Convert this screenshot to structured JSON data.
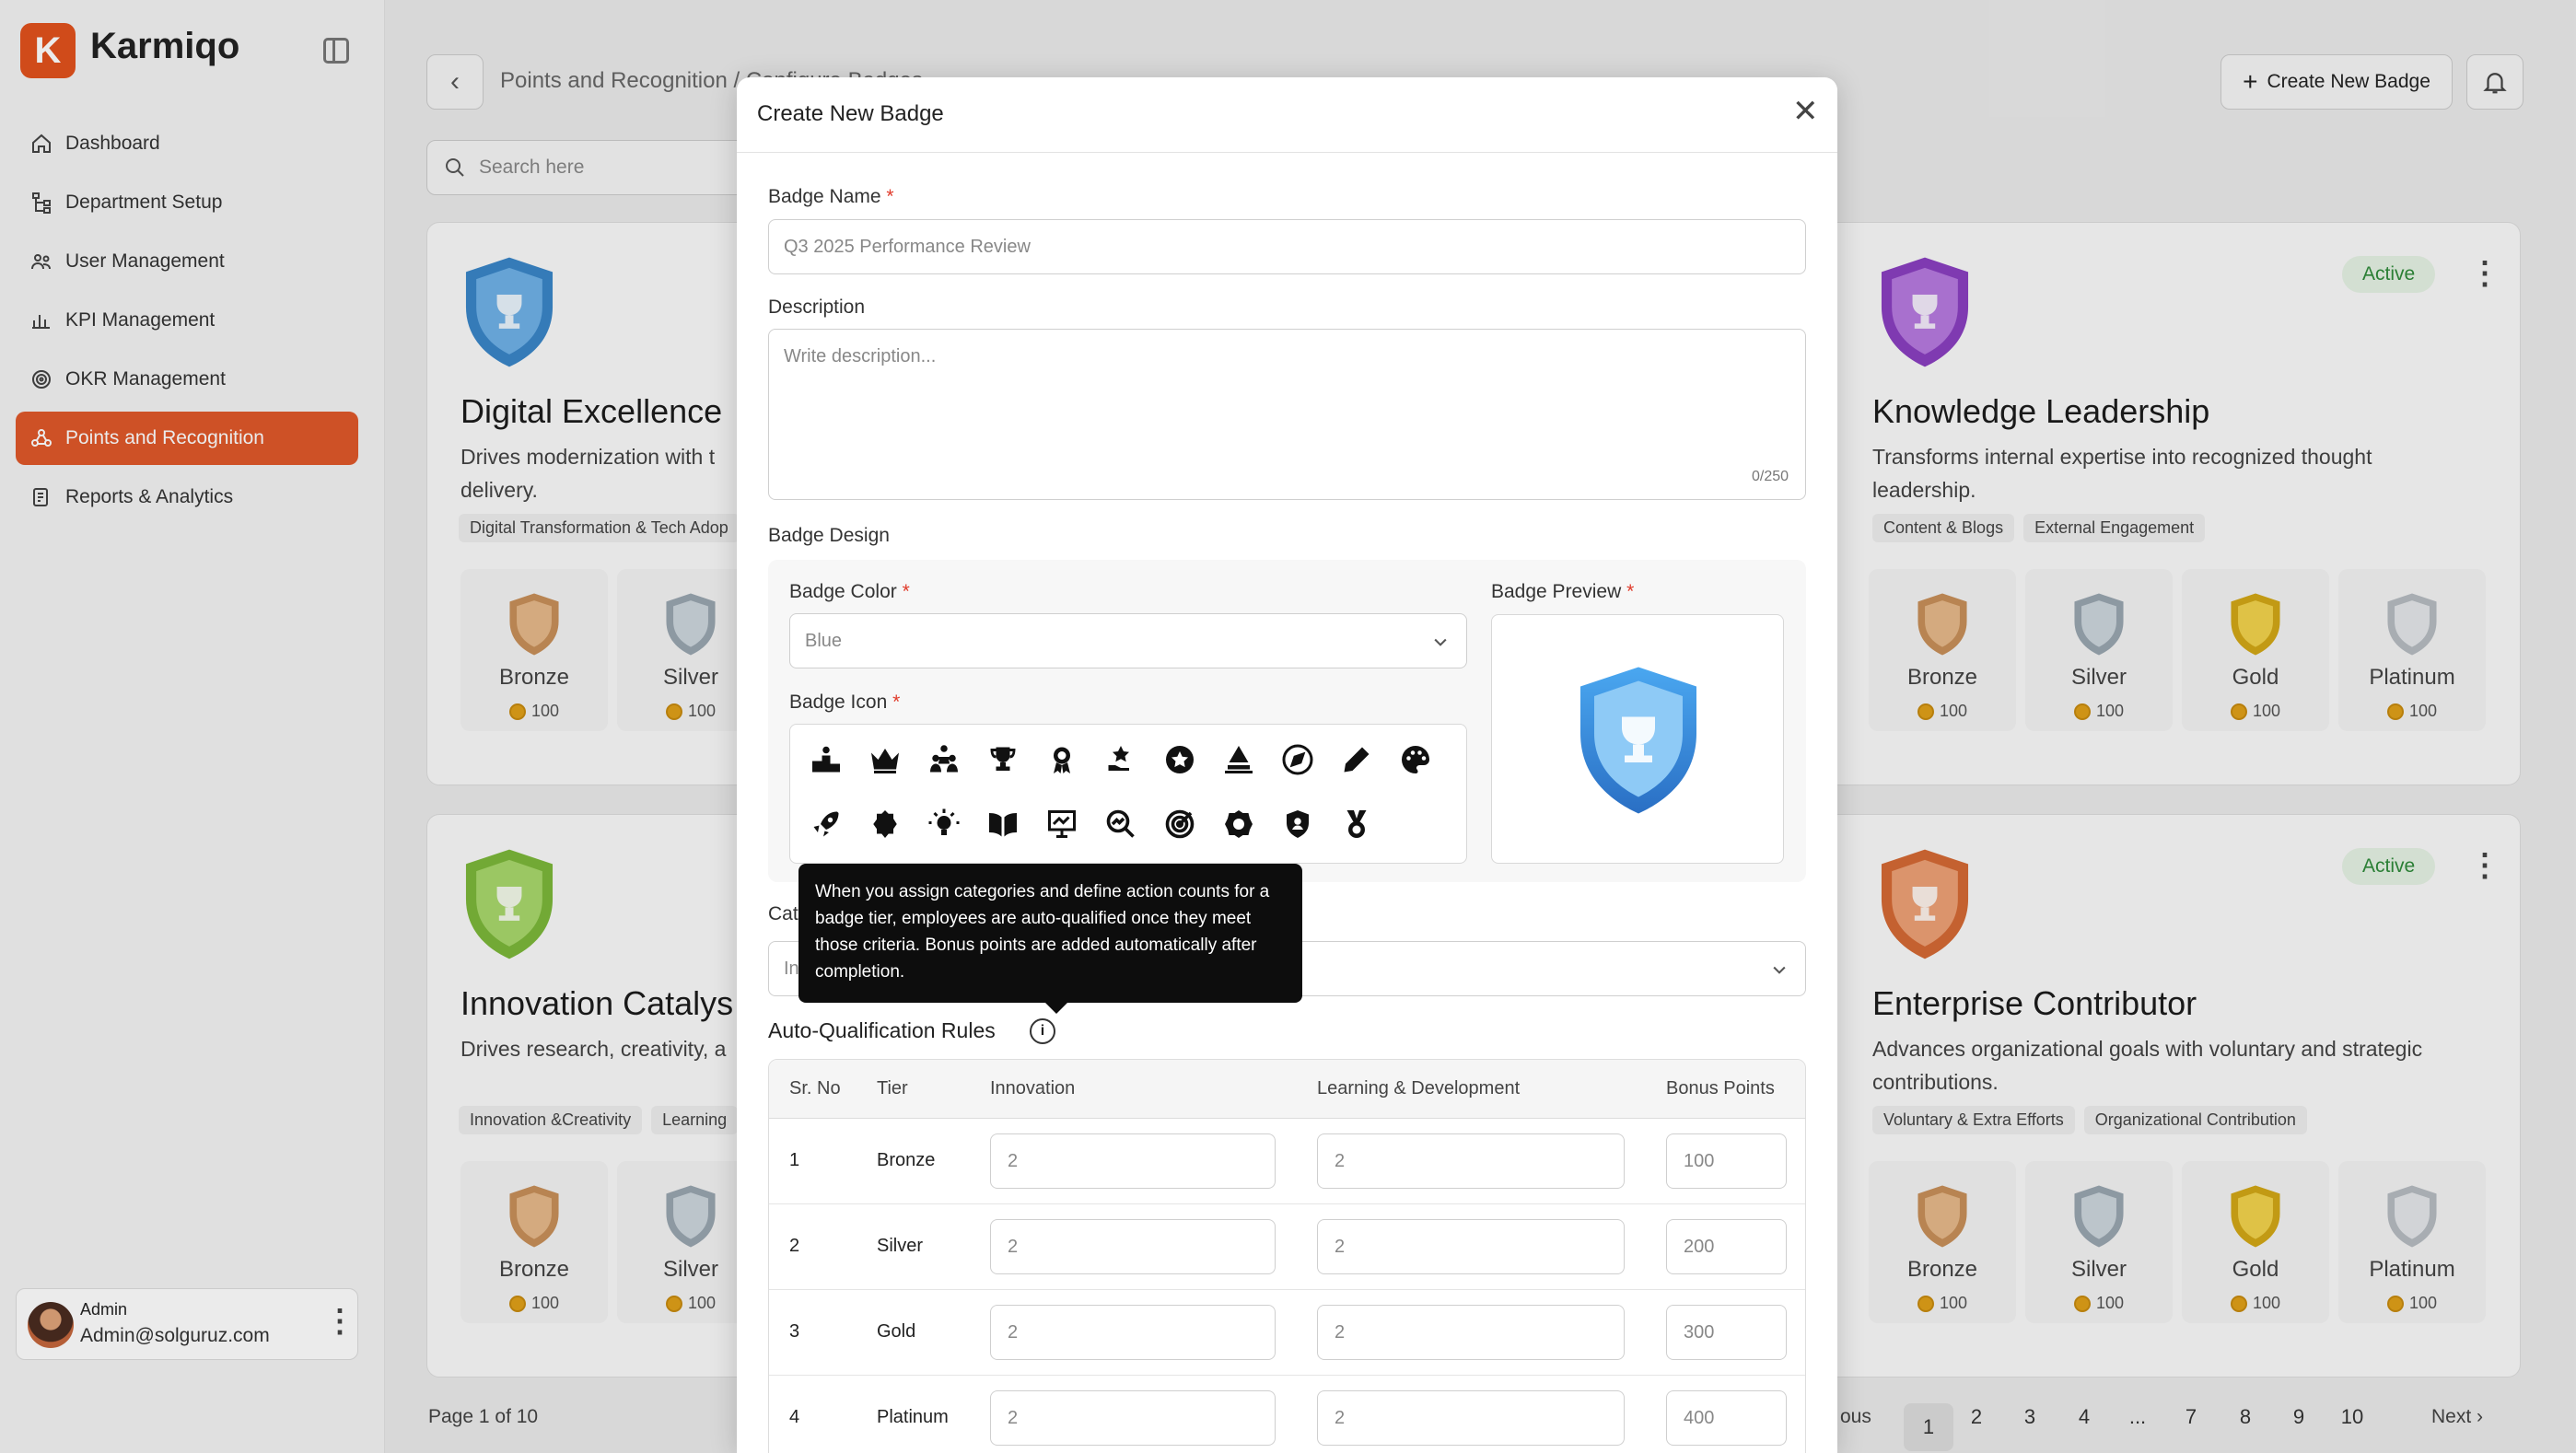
{
  "app": {
    "logo_letter": "K",
    "name": "Karmiqo",
    "accent": "#e0582a"
  },
  "sidebar": {
    "items": [
      {
        "label": "Dashboard",
        "icon": "home-icon"
      },
      {
        "label": "Department Setup",
        "icon": "hierarchy-icon"
      },
      {
        "label": "User Management",
        "icon": "users-icon"
      },
      {
        "label": "KPI Management",
        "icon": "chart-icon"
      },
      {
        "label": "OKR Management",
        "icon": "target-icon"
      },
      {
        "label": "Points and Recognition",
        "icon": "award-icon",
        "active": true
      },
      {
        "label": "Reports & Analytics",
        "icon": "report-icon"
      }
    ],
    "user": {
      "role": "Admin",
      "email": "Admin@solguruz.com"
    }
  },
  "header": {
    "breadcrumb": "Points and Recognition / Configure Badges",
    "search_placeholder": "Search here",
    "create_label": "Create New Badge"
  },
  "cards": [
    {
      "title": "Digital Excellence",
      "desc": "Drives modernization with t",
      "desc2": "delivery.",
      "tags": [
        "Digital Transformation & Tech Adop"
      ],
      "color": "#3a86c8",
      "tiers": [
        {
          "name": "Bronze",
          "pts": "100"
        },
        {
          "name": "Silver",
          "pts": "100"
        }
      ]
    },
    {
      "title": "Knowledge Leadership",
      "desc": "Transforms internal expertise into recognized thought",
      "desc2": "leadership.",
      "status": "Active",
      "tags": [
        "Content & Blogs",
        "External Engagement"
      ],
      "color": "#8a3fc0",
      "tiers": [
        {
          "name": "Bronze",
          "pts": "100"
        },
        {
          "name": "Silver",
          "pts": "100"
        },
        {
          "name": "Gold",
          "pts": "100"
        },
        {
          "name": "Platinum",
          "pts": "100"
        }
      ]
    },
    {
      "title": "Innovation Catalys",
      "desc": "Drives research, creativity, a",
      "desc2": "",
      "tags": [
        "Innovation &Creativity",
        "Learning"
      ],
      "color": "#7cb83a",
      "tiers": [
        {
          "name": "Bronze",
          "pts": "100"
        },
        {
          "name": "Silver",
          "pts": "100"
        }
      ]
    },
    {
      "title": "Enterprise Contributor",
      "desc": "Advances organizational goals with voluntary and strategic",
      "desc2": "contributions.",
      "status": "Active",
      "tags": [
        "Voluntary & Extra Efforts",
        "Organizational Contribution"
      ],
      "color": "#d56a35",
      "tiers": [
        {
          "name": "Bronze",
          "pts": "100"
        },
        {
          "name": "Silver",
          "pts": "100"
        },
        {
          "name": "Gold",
          "pts": "100"
        },
        {
          "name": "Platinum",
          "pts": "100"
        }
      ]
    }
  ],
  "pagination": {
    "info": "Page 1 of 10",
    "prev": "ous",
    "pages": [
      "1",
      "2",
      "3",
      "4",
      "...",
      "7",
      "8",
      "9",
      "10"
    ],
    "next": "Next"
  },
  "modal": {
    "title": "Create New Badge",
    "badge_name_label": "Badge Name",
    "badge_name_value": "Q3 2025 Performance Review",
    "description_label": "Description",
    "description_placeholder": "Write description...",
    "description_count": "0/250",
    "design_label": "Badge Design",
    "color_label": "Badge Color",
    "color_value": "Blue",
    "icon_label": "Badge  Icon",
    "preview_label": "Badge Preview",
    "category_label": "Cat",
    "category_value": "In",
    "rules_label": "Auto-Qualification Rules",
    "tooltip": "When you assign categories and define action counts for a badge tier, employees are auto-qualified once they meet those criteria. Bonus points are added automatically after completion.",
    "required_mark": "*",
    "icons": [
      "podium-icon",
      "crown-icon",
      "team-icon",
      "trophy-icon",
      "ribbon-icon",
      "hand-star-icon",
      "star-icon",
      "pen-nib-icon",
      "compass-icon",
      "pencil-icon",
      "palette-icon",
      "rocket-icon",
      "badge-star-icon",
      "bulb-icon",
      "book-icon",
      "presentation-icon",
      "search-chart-icon",
      "target-icon",
      "shield-badge-icon",
      "shield-icon",
      "medal-icon"
    ],
    "table": {
      "headers": [
        "Sr. No",
        "Tier",
        "Innovation",
        "Learning & Development",
        "Bonus Points"
      ],
      "rows": [
        {
          "sr": "1",
          "tier": "Bronze",
          "innovation": "2",
          "learning": "2",
          "bonus": "100"
        },
        {
          "sr": "2",
          "tier": "Silver",
          "innovation": "2",
          "learning": "2",
          "bonus": "200"
        },
        {
          "sr": "3",
          "tier": "Gold",
          "innovation": "2",
          "learning": "2",
          "bonus": "300"
        },
        {
          "sr": "4",
          "tier": "Platinum",
          "innovation": "2",
          "learning": "2",
          "bonus": "400"
        }
      ]
    }
  }
}
